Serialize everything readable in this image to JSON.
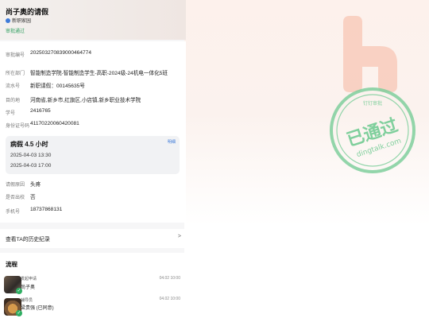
{
  "header": {
    "title": "尚子奥的请假",
    "department": "新职家园",
    "status": "审批通过"
  },
  "info": {
    "rows": [
      {
        "label": "审批编号",
        "value": "202503270839000464774"
      },
      {
        "label": "所在部门",
        "value": "智能制造学院-智能制造学生-高职-2024级-24机电一体化5班"
      },
      {
        "label": "流水号",
        "value": "新职请假：00145635号"
      },
      {
        "label": "目的地",
        "value": "河南省,新乡市,红旗区,小店镇,新乡职业技术学院"
      },
      {
        "label": "学号",
        "value": "2416765"
      },
      {
        "label": "身份证号码",
        "value": "411702200604200​81"
      }
    ],
    "leave": {
      "type": "病假 4.5 小时",
      "detail_link": "明细",
      "start": "2025-04-03 13:30",
      "end": "2025-04-03 17:00"
    },
    "extra_rows": [
      {
        "label": "请假原因",
        "value": "头疼"
      },
      {
        "label": "是否出校",
        "value": "否"
      },
      {
        "label": "手机号",
        "value": "18737868131"
      }
    ]
  },
  "history": {
    "label": "查看TA的历史纪录",
    "arrow": ">"
  },
  "flow": {
    "title": "流程",
    "steps": [
      {
        "action": "发起申请",
        "name": "尚子奥",
        "time": "04.02 10:00"
      },
      {
        "action": "辅导员",
        "name": "梁贵强 (已同意)",
        "time": "04.02 10:00"
      }
    ]
  },
  "stamp": {
    "main": "已通过",
    "sub": "dingtalk.com",
    "top": "钉钉审批"
  },
  "colors": {
    "accent": "#3e7bd9",
    "approved": "#2e9e5e",
    "brand": "#f07b5a"
  }
}
